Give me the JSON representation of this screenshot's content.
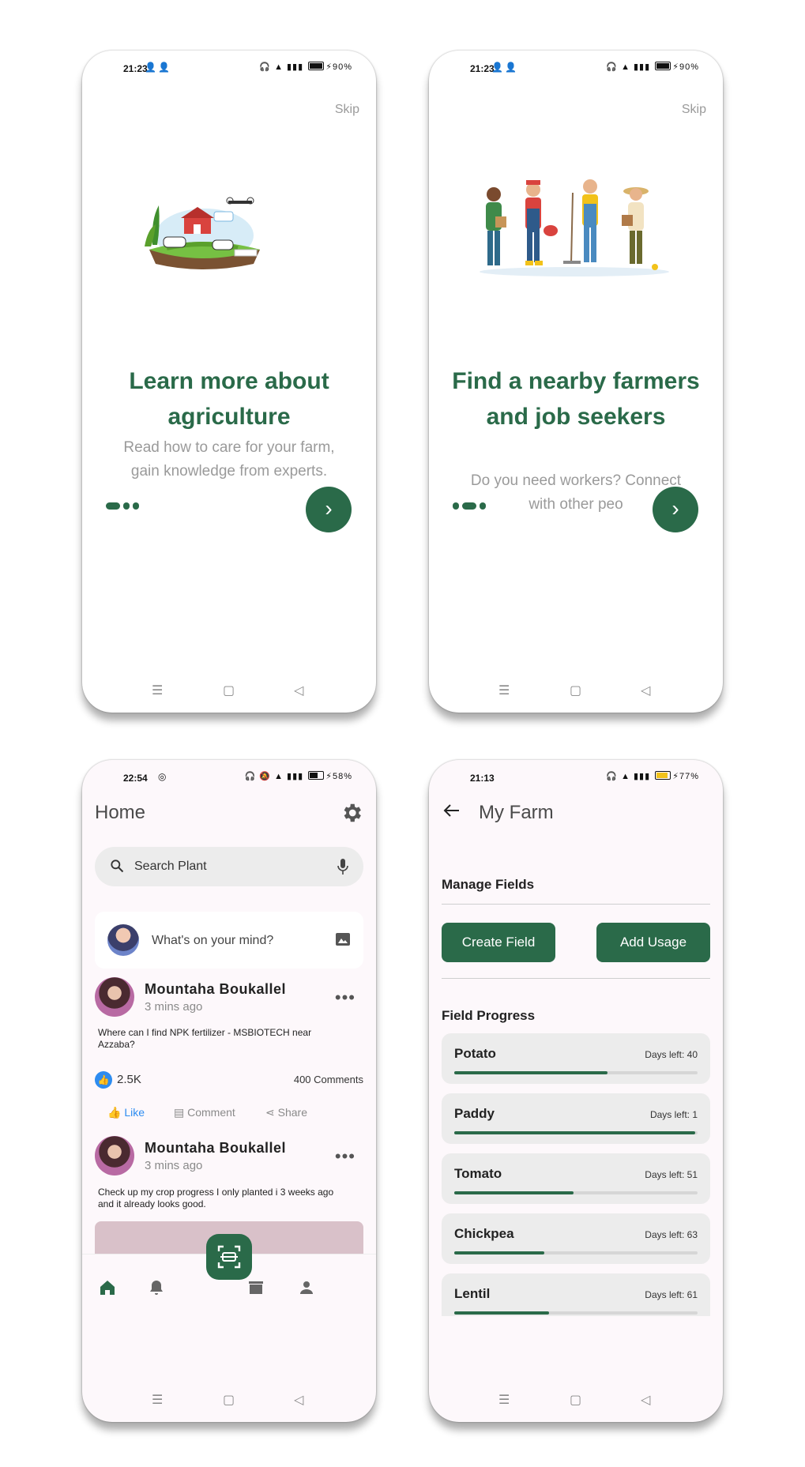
{
  "screens": {
    "onboarding1": {
      "status": {
        "time": "21:23",
        "battery": "90%"
      },
      "skip_label": "Skip",
      "title": "Learn more about agriculture",
      "description": "Read how to care for your farm, gain knowledge from experts.",
      "active_dot": 0,
      "next_icon": "chevron-right-icon"
    },
    "onboarding2": {
      "status": {
        "time": "21:23",
        "battery": "90%"
      },
      "skip_label": "Skip",
      "title": "Find a nearby farmers and job seekers",
      "description": "Do you need workers? Connect with other peo",
      "active_dot": 1,
      "next_icon": "chevron-right-icon"
    },
    "home": {
      "status": {
        "time": "22:54",
        "battery": "58%"
      },
      "title": "Home",
      "search_placeholder": "Search Plant",
      "composer_text": "What's on your mind?",
      "posts": [
        {
          "author": "Mountaha Boukallel",
          "time": "3 mins ago",
          "text": "Where can I find NPK fertilizer - MSBIOTECH near Azzaba?",
          "likes": "2.5K",
          "comments": "400 Comments",
          "actions": {
            "like": "Like",
            "comment": "Comment",
            "share": "Share"
          }
        },
        {
          "author": "Mountaha Boukallel",
          "time": "3 mins ago",
          "text": "Check up my crop progress I only planted i 3 weeks ago and it already looks good."
        }
      ],
      "nav_icons": [
        "home-icon",
        "bell-icon",
        "scan-icon",
        "store-icon",
        "profile-icon"
      ]
    },
    "myfarm": {
      "status": {
        "time": "21:13",
        "battery": "77%"
      },
      "title": "My Farm",
      "manage_title": "Manage Fields",
      "create_label": "Create Field",
      "usage_label": "Add Usage",
      "progress_title": "Field Progress",
      "fields": [
        {
          "name": "Potato",
          "days": "Days left: 40",
          "progress": 0.63
        },
        {
          "name": "Paddy",
          "days": "Days left: 1",
          "progress": 0.99
        },
        {
          "name": "Tomato",
          "days": "Days left: 51",
          "progress": 0.49
        },
        {
          "name": "Chickpea",
          "days": "Days left: 63",
          "progress": 0.37
        },
        {
          "name": "Lentil",
          "days": "Days left: 61",
          "progress": 0.39
        }
      ]
    }
  },
  "colors": {
    "primary": "#2a6a49",
    "like_blue": "#2d8cf0",
    "muted_text": "#9a9a9a",
    "card_bg": "#ececec"
  }
}
